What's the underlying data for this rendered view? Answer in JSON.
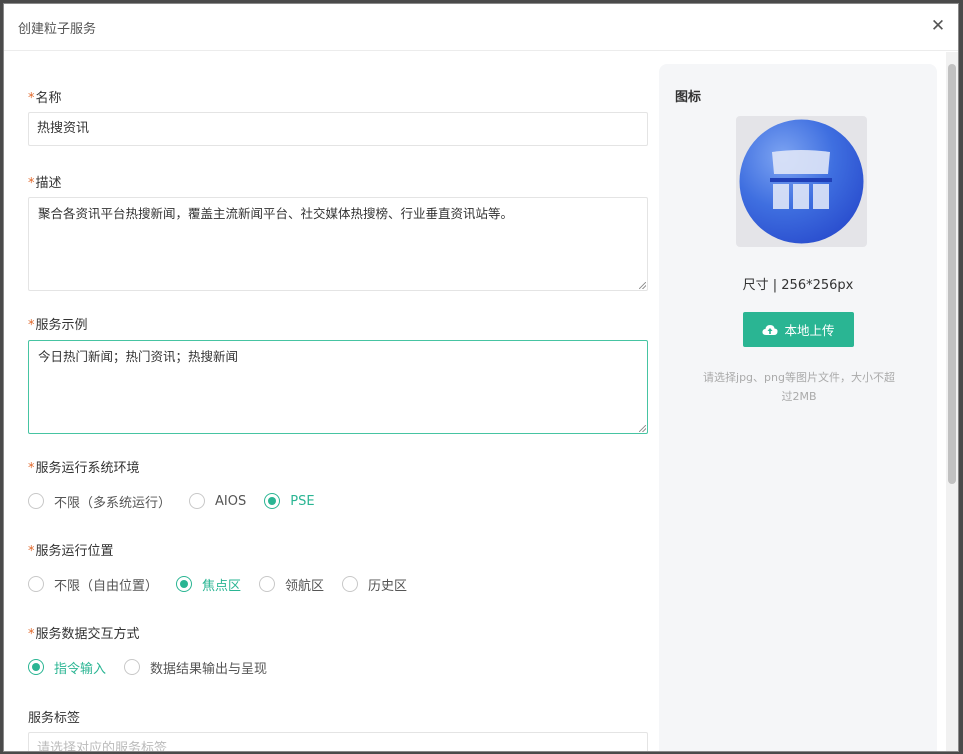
{
  "dialog": {
    "title": "创建粒子服务"
  },
  "form": {
    "name": {
      "label": "名称",
      "required": true,
      "value": "热搜资讯"
    },
    "description": {
      "label": "描述",
      "required": true,
      "value": "聚合各资讯平台热搜新闻，覆盖主流新闻平台、社交媒体热搜榜、行业垂直资讯站等。"
    },
    "example": {
      "label": "服务示例",
      "required": true,
      "value": "今日热门新闻；热门资讯；热搜新闻"
    },
    "env": {
      "label": "服务运行系统环境",
      "required": true,
      "options": [
        "不限（多系统运行）",
        "AIOS",
        "PSE"
      ],
      "selected": "PSE"
    },
    "position": {
      "label": "服务运行位置",
      "required": true,
      "options": [
        "不限（自由位置）",
        "焦点区",
        "领航区",
        "历史区"
      ],
      "selected": "焦点区"
    },
    "interaction": {
      "label": "服务数据交互方式",
      "required": true,
      "options": [
        "指令输入",
        "数据结果输出与呈现"
      ],
      "selected": "指令输入"
    },
    "tags": {
      "label": "服务标签",
      "placeholder": "请选择对应的服务标签"
    }
  },
  "icon_panel": {
    "title": "图标",
    "size": "尺寸 | 256*256px",
    "upload_label": "本地上传",
    "hint": "请选择jpg、png等图片文件，大小不超过2MB"
  },
  "colors": {
    "accent": "#2ab593",
    "required_star": "#e0682b",
    "side_panel_bg": "#f5f6f8"
  }
}
